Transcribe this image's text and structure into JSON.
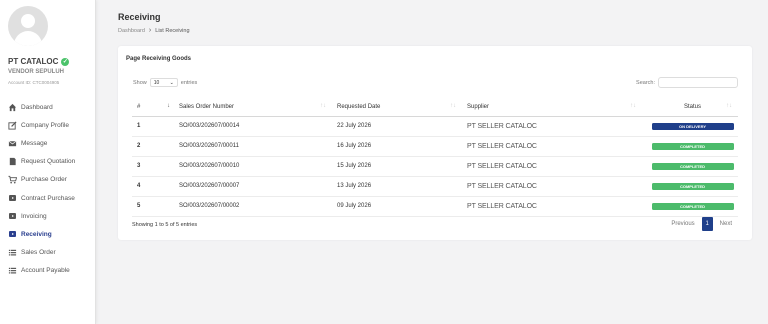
{
  "sidebar": {
    "company_name": "PT CATALOC",
    "vendor_name": "VENDOR SEPULUH",
    "account_id": "Account ID: CTC0004905",
    "items": [
      {
        "label": "Dashboard",
        "icon": "home-icon"
      },
      {
        "label": "Company Profile",
        "icon": "edit-icon"
      },
      {
        "label": "Message",
        "icon": "envelope-icon"
      },
      {
        "label": "Request Quotation",
        "icon": "document-icon"
      },
      {
        "label": "Purchase Order",
        "icon": "cart-icon"
      },
      {
        "label": "Contract Purchase",
        "icon": "play-square-icon"
      },
      {
        "label": "Invoicing",
        "icon": "play-square-icon"
      },
      {
        "label": "Receiving",
        "icon": "play-square-icon"
      },
      {
        "label": "Sales Order",
        "icon": "list-icon"
      },
      {
        "label": "Account Payable",
        "icon": "list-icon"
      }
    ]
  },
  "header": {
    "title": "Receiving",
    "breadcrumb_home": "Dashboard",
    "breadcrumb_current": "List Receiving"
  },
  "card": {
    "title": "Page Receiving Goods",
    "show_label": "Show",
    "entries_value": "10",
    "entries_label": "entries",
    "search_label": "Search:",
    "columns": [
      "#",
      "Sales Order Number",
      "Requested Date",
      "Supplier",
      "Status"
    ],
    "rows": [
      {
        "num": "1",
        "so": "SO/003/202607/00014",
        "date": "22 July 2026",
        "supplier": "PT SELLER CATALOC",
        "status": "ON DELIVERY"
      },
      {
        "num": "2",
        "so": "SO/003/202607/00011",
        "date": "16 July 2026",
        "supplier": "PT SELLER CATALOC",
        "status": "COMPLETED"
      },
      {
        "num": "3",
        "so": "SO/003/202607/00010",
        "date": "15 July 2026",
        "supplier": "PT SELLER CATALOC",
        "status": "COMPLETED"
      },
      {
        "num": "4",
        "so": "SO/003/202607/00007",
        "date": "13 July 2026",
        "supplier": "PT SELLER CATALOC",
        "status": "COMPLETED"
      },
      {
        "num": "5",
        "so": "SO/003/202607/00002",
        "date": "09 July 2026",
        "supplier": "PT SELLER CATALOC",
        "status": "COMPLETED"
      }
    ],
    "showing_text": "Showing 1 to 5 of 5 entries",
    "pagination": {
      "previous": "Previous",
      "current": "1",
      "next": "Next"
    }
  },
  "colors": {
    "accent": "#1f3f8a",
    "status_on_delivery": "#1f3f8a",
    "status_completed": "#4cbb6b",
    "verified": "#4cc36b"
  }
}
